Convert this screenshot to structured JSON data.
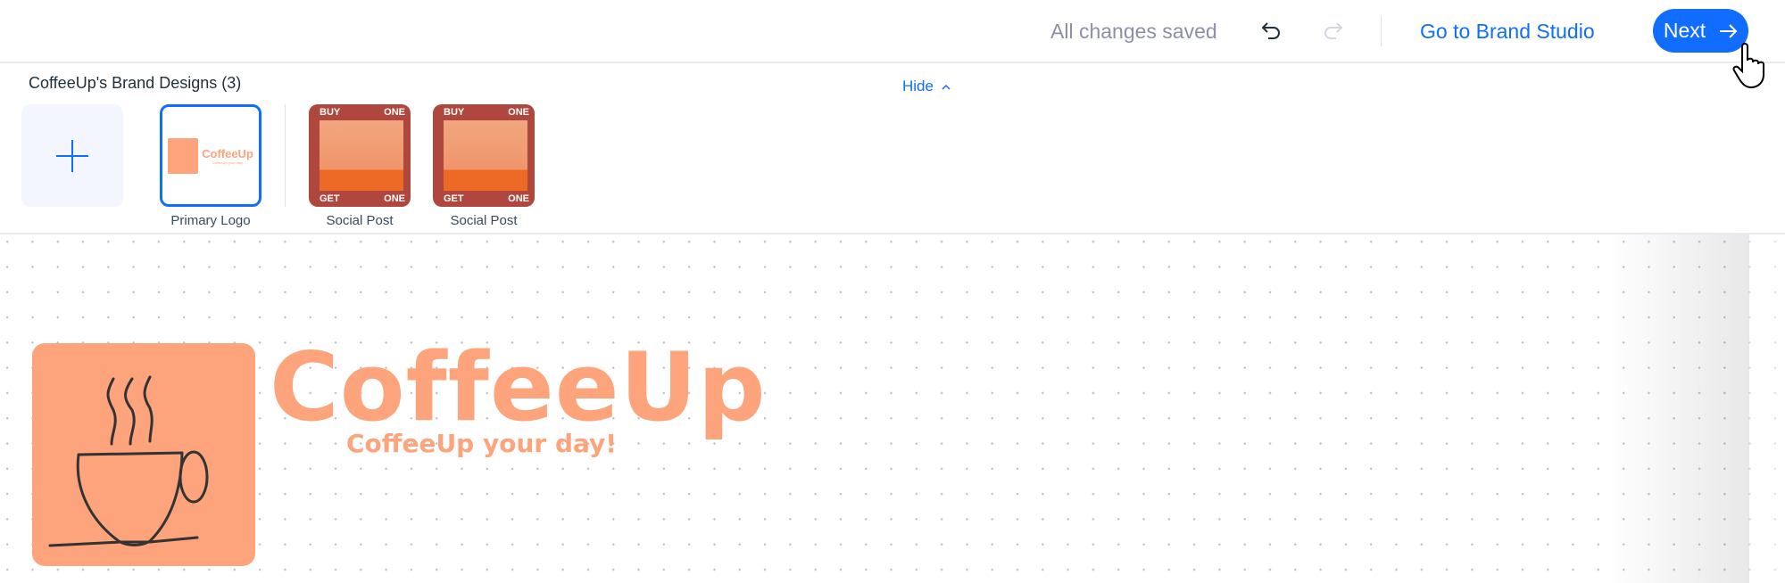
{
  "topbar": {
    "status": "All changes saved",
    "undo_icon": "undo-icon",
    "redo_icon": "redo-icon",
    "brand_studio_link": "Go to Brand Studio",
    "next_label": "Next",
    "accent": "#116dff"
  },
  "panel": {
    "title": "CoffeeUp's Brand Designs (3)",
    "hide_label": "Hide",
    "designs": [
      {
        "label": "Primary Logo",
        "selected": true
      },
      {
        "label": "Social Post",
        "top_left": "BUY",
        "top_right": "ONE",
        "bottom_left": "GET",
        "bottom_right": "ONE"
      },
      {
        "label": "Social Post",
        "top_left": "BUY",
        "top_right": "ONE",
        "bottom_left": "GET",
        "bottom_right": "ONE"
      }
    ]
  },
  "canvas": {
    "brand_name": "CoffeeUp",
    "tagline": "CoffeeUp your day!",
    "brand_color": "#fea47c"
  }
}
